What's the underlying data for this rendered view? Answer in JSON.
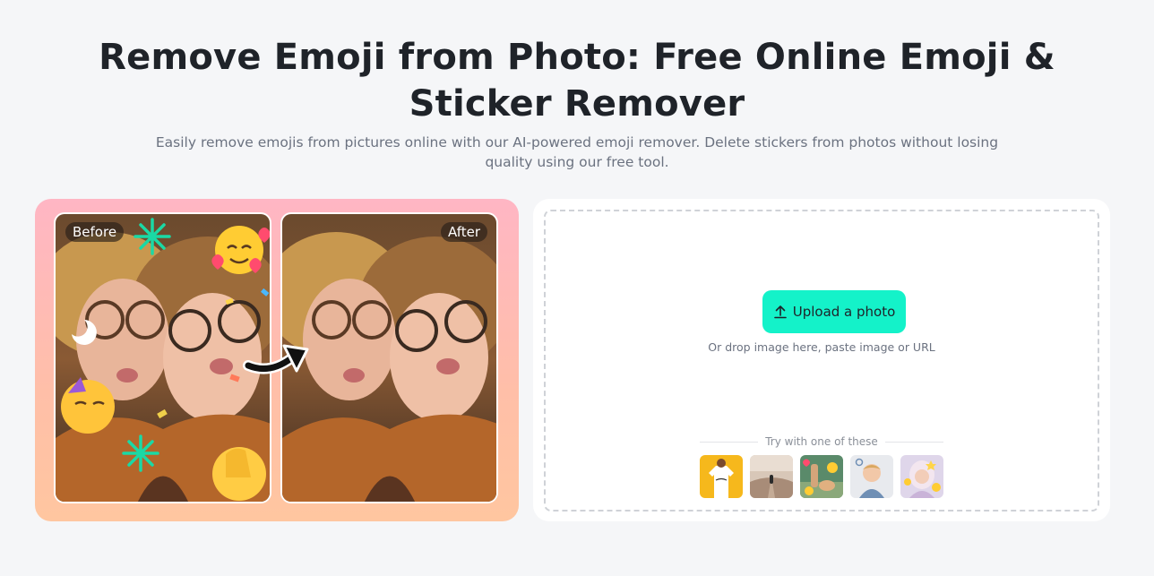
{
  "hero": {
    "title_line1": "Remove Emoji from Photo: Free Online Emoji &",
    "title_line2": "Sticker Remover",
    "subtitle": "Easily remove emojis from pictures online with our AI-powered emoji remover. Delete stickers from photos without losing quality using our free tool."
  },
  "demo": {
    "before_label": "Before",
    "after_label": "After"
  },
  "upload": {
    "button_label": "Upload a photo",
    "button_icon": "upload-icon",
    "drop_hint": "Or drop image here, paste image or URL",
    "try_label": "Try with one of these",
    "samples": [
      {
        "name": "sample-tshirt"
      },
      {
        "name": "sample-road"
      },
      {
        "name": "sample-dog-emoji"
      },
      {
        "name": "sample-child"
      },
      {
        "name": "sample-girl-emoji"
      }
    ]
  },
  "colors": {
    "accent": "#14f2c9",
    "background": "#f5f6f8",
    "card_gradient_top": "#ffb6c4",
    "card_gradient_bottom": "#ffc6a0"
  }
}
